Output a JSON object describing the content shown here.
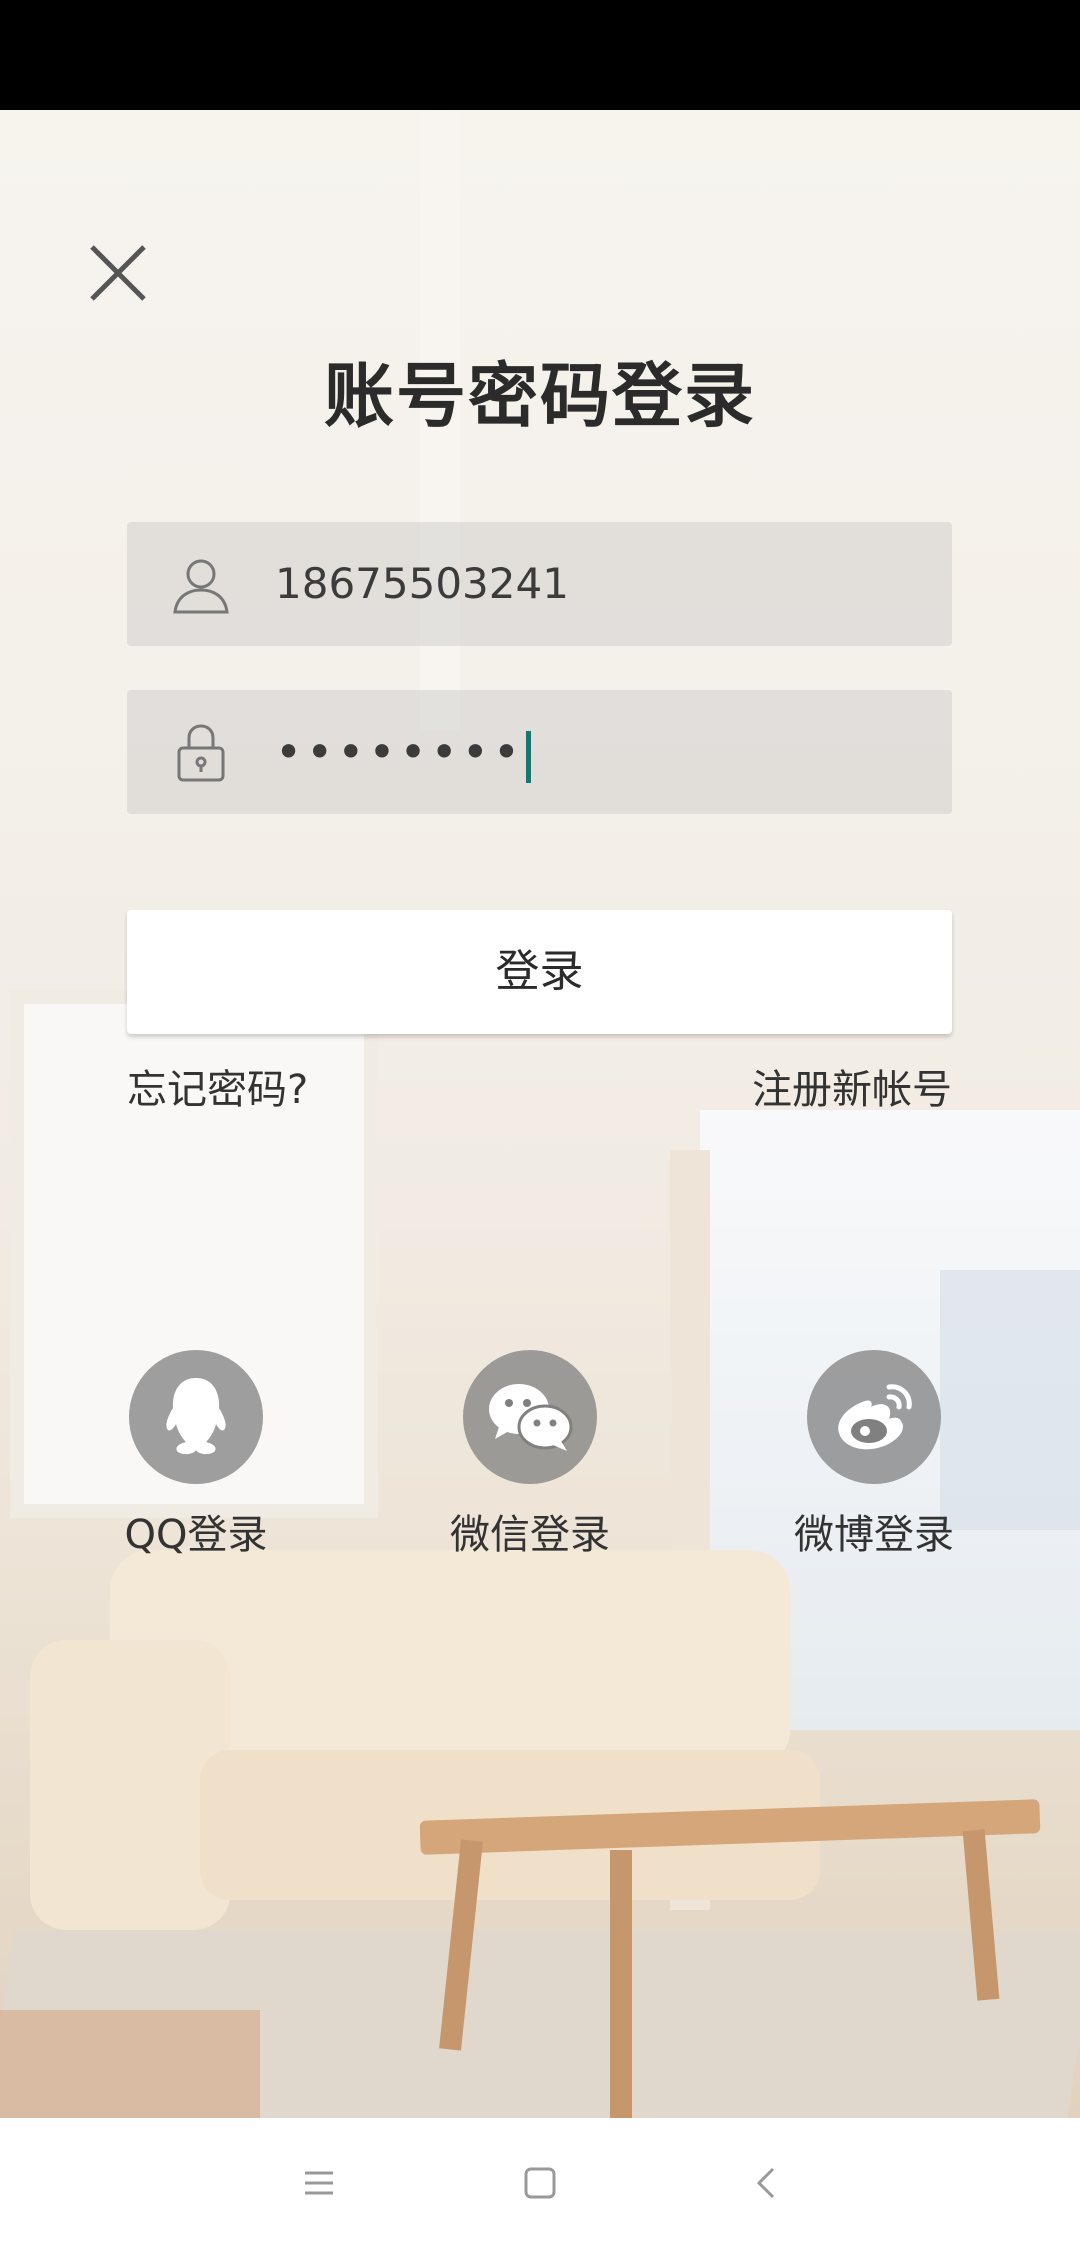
{
  "title": "账号密码登录",
  "phone_field": {
    "value": "18675503241"
  },
  "password_field": {
    "masked_value": "••••••••"
  },
  "login_button": "登录",
  "forgot_password": "忘记密码?",
  "register": "注册新帐号",
  "social_logins": [
    {
      "label": "QQ登录",
      "icon": "qq-icon"
    },
    {
      "label": "微信登录",
      "icon": "wechat-icon"
    },
    {
      "label": "微博登录",
      "icon": "weibo-icon"
    }
  ],
  "colors": {
    "caret": "#0d7b73",
    "social_circle": "#808080"
  }
}
